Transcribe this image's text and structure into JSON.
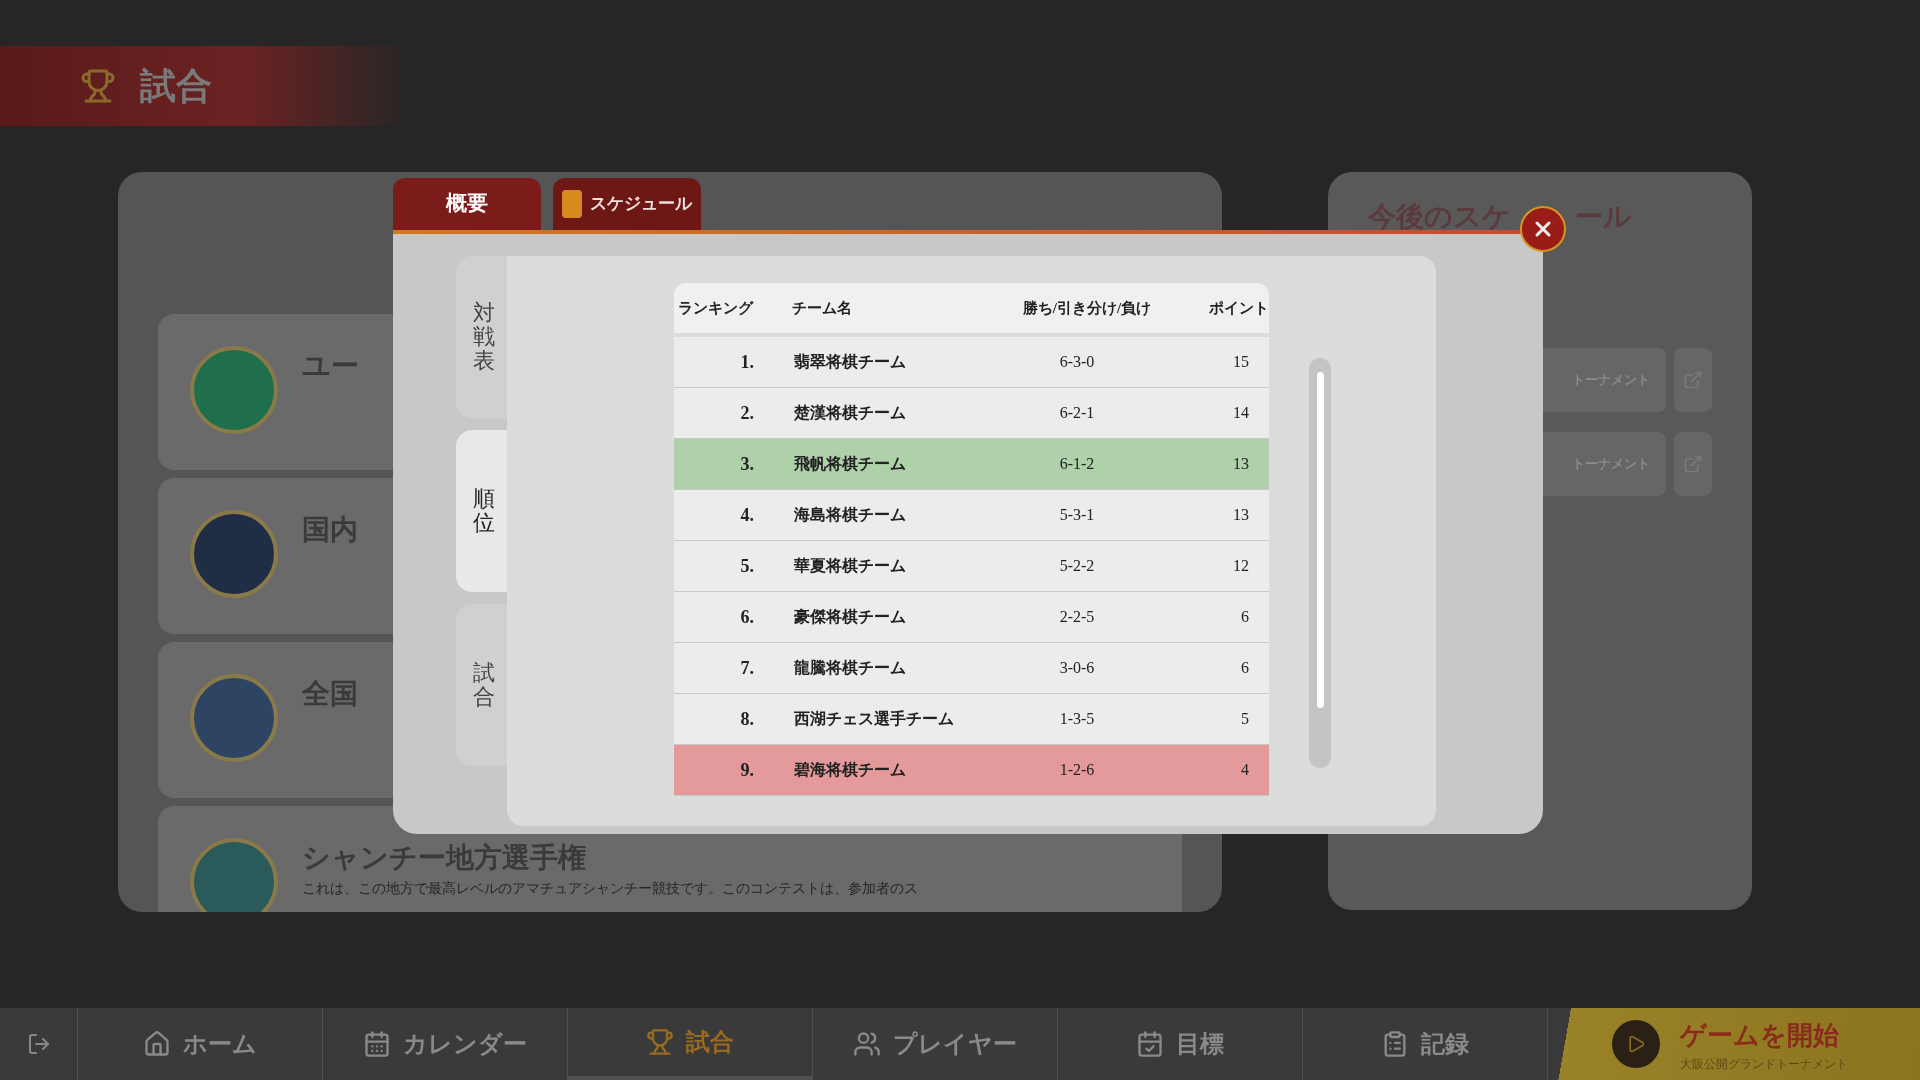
{
  "header": {
    "title": "試合"
  },
  "background_events": [
    {
      "title": "ユー"
    },
    {
      "title": "国内"
    },
    {
      "title": "全国"
    },
    {
      "title": "シャンチー地方選手権",
      "description": "これは、この地方で最高レベルのアマチュアシャンチー競技です。このコンテストは、参加者のス"
    }
  ],
  "upcoming_schedule": {
    "title": "今後のスケ",
    "title_tail": "ール",
    "items": [
      {
        "title": "トーナメント"
      },
      {
        "title": "トーナメント"
      }
    ]
  },
  "modal": {
    "tabs": [
      {
        "label": "概要",
        "selected": true
      },
      {
        "label": "スケジュール",
        "selected": false
      }
    ],
    "side_tabs": [
      {
        "label": "対戦表",
        "selected": false
      },
      {
        "label": "順位",
        "selected": true
      },
      {
        "label": "試合",
        "selected": false
      }
    ],
    "table": {
      "columns": [
        "ランキング",
        "チーム名",
        "勝ち/引き分け/負け",
        "ポイント"
      ],
      "rows": [
        {
          "rank": "1.",
          "team": "翡翠将棋チーム",
          "record": "6-3-0",
          "points": "15",
          "kind": "normal"
        },
        {
          "rank": "2.",
          "team": "楚漢将棋チーム",
          "record": "6-2-1",
          "points": "14",
          "kind": "normal"
        },
        {
          "rank": "3.",
          "team": "飛帆将棋チーム",
          "record": "6-1-2",
          "points": "13",
          "kind": "promotion"
        },
        {
          "rank": "4.",
          "team": "海島将棋チーム",
          "record": "5-3-1",
          "points": "13",
          "kind": "normal"
        },
        {
          "rank": "5.",
          "team": "華夏将棋チーム",
          "record": "5-2-2",
          "points": "12",
          "kind": "normal"
        },
        {
          "rank": "6.",
          "team": "豪傑将棋チーム",
          "record": "2-2-5",
          "points": "6",
          "kind": "normal"
        },
        {
          "rank": "7.",
          "team": "龍騰将棋チーム",
          "record": "3-0-6",
          "points": "6",
          "kind": "normal"
        },
        {
          "rank": "8.",
          "team": "西湖チェス選手チーム",
          "record": "1-3-5",
          "points": "5",
          "kind": "normal"
        },
        {
          "rank": "9.",
          "team": "碧海将棋チーム",
          "record": "1-2-6",
          "points": "4",
          "kind": "relegation"
        }
      ]
    }
  },
  "nav": {
    "items": [
      {
        "label": "ホーム",
        "selected": false
      },
      {
        "label": "カレンダー",
        "selected": false
      },
      {
        "label": "試合",
        "selected": true
      },
      {
        "label": "プレイヤー",
        "selected": false
      },
      {
        "label": "目標",
        "selected": false
      },
      {
        "label": "記録",
        "selected": false
      }
    ],
    "start": {
      "label": "ゲームを開始",
      "subtitle": "大阪公開グランドトーナメント"
    }
  }
}
